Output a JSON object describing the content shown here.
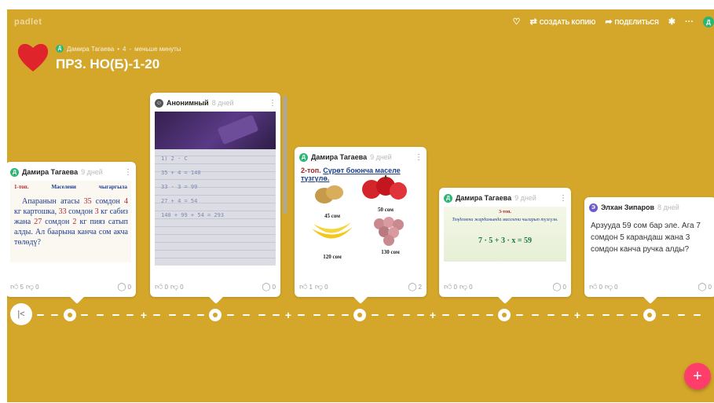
{
  "app": {
    "brand": "padlet"
  },
  "toolbar": {
    "remake_label": "СОЗДАТЬ КОПИЮ",
    "share_label": "ПОДЕЛИТЬСЯ",
    "heart_icon": "heart-outline-icon",
    "remake_icon": "remake-icon",
    "share_icon": "share-icon",
    "settings_icon": "gear-icon",
    "more_icon": "more-icon",
    "user_initial": "Д"
  },
  "header": {
    "author_initial": "Д",
    "author": "Дамира Тагаева",
    "separator": "•",
    "count": "4",
    "dash": "-",
    "time": "меньше минуты",
    "title": "ПРЗ. НО(Б)-1-20"
  },
  "cards": [
    {
      "initial": "Д",
      "avatar_color": "#2bb673",
      "author": "Дамира Тагаева",
      "time": "9 дней",
      "doc_header": [
        "1-топ.",
        "Маселени",
        "чыгаргыла"
      ],
      "doc_text": [
        "Апаранын атасы ",
        "35",
        " сомдон ",
        "4",
        " кг картошка, ",
        "33",
        " сомдон ",
        "3",
        " кг сабиз жана ",
        "27",
        " сомдон ",
        "2",
        " кг пияз сатып алды. Ал баарына канча сом акча төлөдү?"
      ],
      "likes": "5",
      "dislikes": "0",
      "comments": "0"
    },
    {
      "initial": "",
      "avatar_color": "#555555",
      "author": "Анонимный",
      "time": "8 дней",
      "photo_lines": [
        "1) 2 · С",
        "35 + 4 = 140",
        "33 · 3 = 99",
        "27 + 4 = 54",
        "140 + 99 + 54 = 293"
      ],
      "likes": "0",
      "dislikes": "0",
      "comments": "0"
    },
    {
      "initial": "Д",
      "avatar_color": "#2bb673",
      "author": "Дамира Тагаева",
      "time": "9 дней",
      "caption_prefix": "2-топ. ",
      "caption_link": "Сүрөт боюнча маселе түзгүлө.",
      "prices": [
        "45 сом",
        "50 сом",
        "120 сом",
        "130 сом"
      ],
      "likes": "1",
      "dislikes": "0",
      "comments": "2"
    },
    {
      "initial": "Д",
      "avatar_color": "#2bb673",
      "author": "Дамира Тагаева",
      "time": "9 дней",
      "eq_header": "3-топ.",
      "eq_instruction": "Теңдемени жардамында маселени чыгарып түзгүлө.",
      "eq_formula": "7 · 5 + 3 · x = 59",
      "likes": "0",
      "dislikes": "0",
      "comments": "0"
    },
    {
      "initial": "Э",
      "avatar_color": "#6a5acd",
      "author": "Элхан Зипаров",
      "time": "8 дней",
      "text": "Арзуудa 59 сом бар эле. Ага 7 сомдон 5 карандаш жана 3 сомдон канча ручка алды?",
      "likes": "0",
      "dislikes": "0",
      "comments": "0"
    }
  ],
  "timeline": {
    "start_icon": "jump-to-start-icon"
  },
  "fab": {
    "label": "+"
  },
  "colors": {
    "background": "#d4a62a",
    "fab": "#ff3d6a",
    "heart": "#e0242b",
    "avatar_green": "#2bb673"
  }
}
